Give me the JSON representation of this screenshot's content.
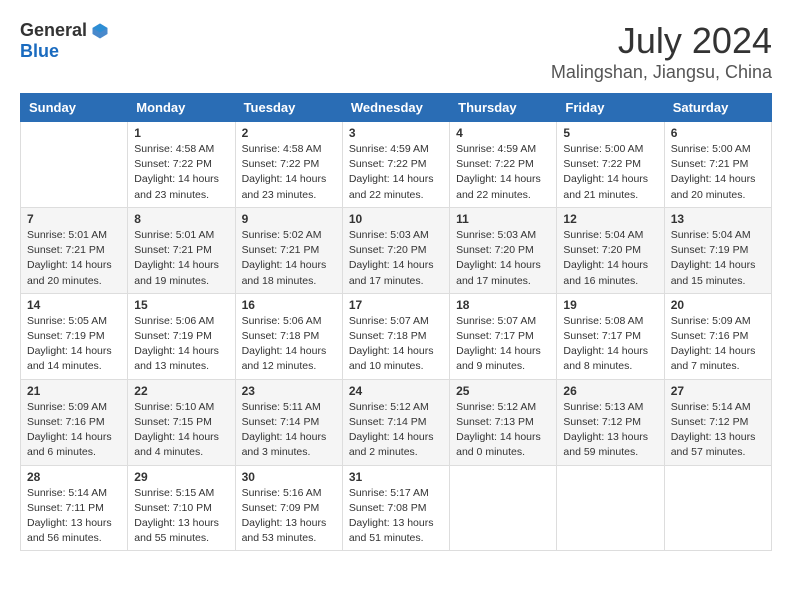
{
  "header": {
    "logo_general": "General",
    "logo_blue": "Blue",
    "title": "July 2024",
    "subtitle": "Malingshan, Jiangsu, China"
  },
  "calendar": {
    "days_of_week": [
      "Sunday",
      "Monday",
      "Tuesday",
      "Wednesday",
      "Thursday",
      "Friday",
      "Saturday"
    ],
    "weeks": [
      [
        {
          "day": "",
          "sunrise": "",
          "sunset": "",
          "daylight": ""
        },
        {
          "day": "1",
          "sunrise": "Sunrise: 4:58 AM",
          "sunset": "Sunset: 7:22 PM",
          "daylight": "Daylight: 14 hours and 23 minutes."
        },
        {
          "day": "2",
          "sunrise": "Sunrise: 4:58 AM",
          "sunset": "Sunset: 7:22 PM",
          "daylight": "Daylight: 14 hours and 23 minutes."
        },
        {
          "day": "3",
          "sunrise": "Sunrise: 4:59 AM",
          "sunset": "Sunset: 7:22 PM",
          "daylight": "Daylight: 14 hours and 22 minutes."
        },
        {
          "day": "4",
          "sunrise": "Sunrise: 4:59 AM",
          "sunset": "Sunset: 7:22 PM",
          "daylight": "Daylight: 14 hours and 22 minutes."
        },
        {
          "day": "5",
          "sunrise": "Sunrise: 5:00 AM",
          "sunset": "Sunset: 7:22 PM",
          "daylight": "Daylight: 14 hours and 21 minutes."
        },
        {
          "day": "6",
          "sunrise": "Sunrise: 5:00 AM",
          "sunset": "Sunset: 7:21 PM",
          "daylight": "Daylight: 14 hours and 20 minutes."
        }
      ],
      [
        {
          "day": "7",
          "sunrise": "Sunrise: 5:01 AM",
          "sunset": "Sunset: 7:21 PM",
          "daylight": "Daylight: 14 hours and 20 minutes."
        },
        {
          "day": "8",
          "sunrise": "Sunrise: 5:01 AM",
          "sunset": "Sunset: 7:21 PM",
          "daylight": "Daylight: 14 hours and 19 minutes."
        },
        {
          "day": "9",
          "sunrise": "Sunrise: 5:02 AM",
          "sunset": "Sunset: 7:21 PM",
          "daylight": "Daylight: 14 hours and 18 minutes."
        },
        {
          "day": "10",
          "sunrise": "Sunrise: 5:03 AM",
          "sunset": "Sunset: 7:20 PM",
          "daylight": "Daylight: 14 hours and 17 minutes."
        },
        {
          "day": "11",
          "sunrise": "Sunrise: 5:03 AM",
          "sunset": "Sunset: 7:20 PM",
          "daylight": "Daylight: 14 hours and 17 minutes."
        },
        {
          "day": "12",
          "sunrise": "Sunrise: 5:04 AM",
          "sunset": "Sunset: 7:20 PM",
          "daylight": "Daylight: 14 hours and 16 minutes."
        },
        {
          "day": "13",
          "sunrise": "Sunrise: 5:04 AM",
          "sunset": "Sunset: 7:19 PM",
          "daylight": "Daylight: 14 hours and 15 minutes."
        }
      ],
      [
        {
          "day": "14",
          "sunrise": "Sunrise: 5:05 AM",
          "sunset": "Sunset: 7:19 PM",
          "daylight": "Daylight: 14 hours and 14 minutes."
        },
        {
          "day": "15",
          "sunrise": "Sunrise: 5:06 AM",
          "sunset": "Sunset: 7:19 PM",
          "daylight": "Daylight: 14 hours and 13 minutes."
        },
        {
          "day": "16",
          "sunrise": "Sunrise: 5:06 AM",
          "sunset": "Sunset: 7:18 PM",
          "daylight": "Daylight: 14 hours and 12 minutes."
        },
        {
          "day": "17",
          "sunrise": "Sunrise: 5:07 AM",
          "sunset": "Sunset: 7:18 PM",
          "daylight": "Daylight: 14 hours and 10 minutes."
        },
        {
          "day": "18",
          "sunrise": "Sunrise: 5:07 AM",
          "sunset": "Sunset: 7:17 PM",
          "daylight": "Daylight: 14 hours and 9 minutes."
        },
        {
          "day": "19",
          "sunrise": "Sunrise: 5:08 AM",
          "sunset": "Sunset: 7:17 PM",
          "daylight": "Daylight: 14 hours and 8 minutes."
        },
        {
          "day": "20",
          "sunrise": "Sunrise: 5:09 AM",
          "sunset": "Sunset: 7:16 PM",
          "daylight": "Daylight: 14 hours and 7 minutes."
        }
      ],
      [
        {
          "day": "21",
          "sunrise": "Sunrise: 5:09 AM",
          "sunset": "Sunset: 7:16 PM",
          "daylight": "Daylight: 14 hours and 6 minutes."
        },
        {
          "day": "22",
          "sunrise": "Sunrise: 5:10 AM",
          "sunset": "Sunset: 7:15 PM",
          "daylight": "Daylight: 14 hours and 4 minutes."
        },
        {
          "day": "23",
          "sunrise": "Sunrise: 5:11 AM",
          "sunset": "Sunset: 7:14 PM",
          "daylight": "Daylight: 14 hours and 3 minutes."
        },
        {
          "day": "24",
          "sunrise": "Sunrise: 5:12 AM",
          "sunset": "Sunset: 7:14 PM",
          "daylight": "Daylight: 14 hours and 2 minutes."
        },
        {
          "day": "25",
          "sunrise": "Sunrise: 5:12 AM",
          "sunset": "Sunset: 7:13 PM",
          "daylight": "Daylight: 14 hours and 0 minutes."
        },
        {
          "day": "26",
          "sunrise": "Sunrise: 5:13 AM",
          "sunset": "Sunset: 7:12 PM",
          "daylight": "Daylight: 13 hours and 59 minutes."
        },
        {
          "day": "27",
          "sunrise": "Sunrise: 5:14 AM",
          "sunset": "Sunset: 7:12 PM",
          "daylight": "Daylight: 13 hours and 57 minutes."
        }
      ],
      [
        {
          "day": "28",
          "sunrise": "Sunrise: 5:14 AM",
          "sunset": "Sunset: 7:11 PM",
          "daylight": "Daylight: 13 hours and 56 minutes."
        },
        {
          "day": "29",
          "sunrise": "Sunrise: 5:15 AM",
          "sunset": "Sunset: 7:10 PM",
          "daylight": "Daylight: 13 hours and 55 minutes."
        },
        {
          "day": "30",
          "sunrise": "Sunrise: 5:16 AM",
          "sunset": "Sunset: 7:09 PM",
          "daylight": "Daylight: 13 hours and 53 minutes."
        },
        {
          "day": "31",
          "sunrise": "Sunrise: 5:17 AM",
          "sunset": "Sunset: 7:08 PM",
          "daylight": "Daylight: 13 hours and 51 minutes."
        },
        {
          "day": "",
          "sunrise": "",
          "sunset": "",
          "daylight": ""
        },
        {
          "day": "",
          "sunrise": "",
          "sunset": "",
          "daylight": ""
        },
        {
          "day": "",
          "sunrise": "",
          "sunset": "",
          "daylight": ""
        }
      ]
    ]
  }
}
